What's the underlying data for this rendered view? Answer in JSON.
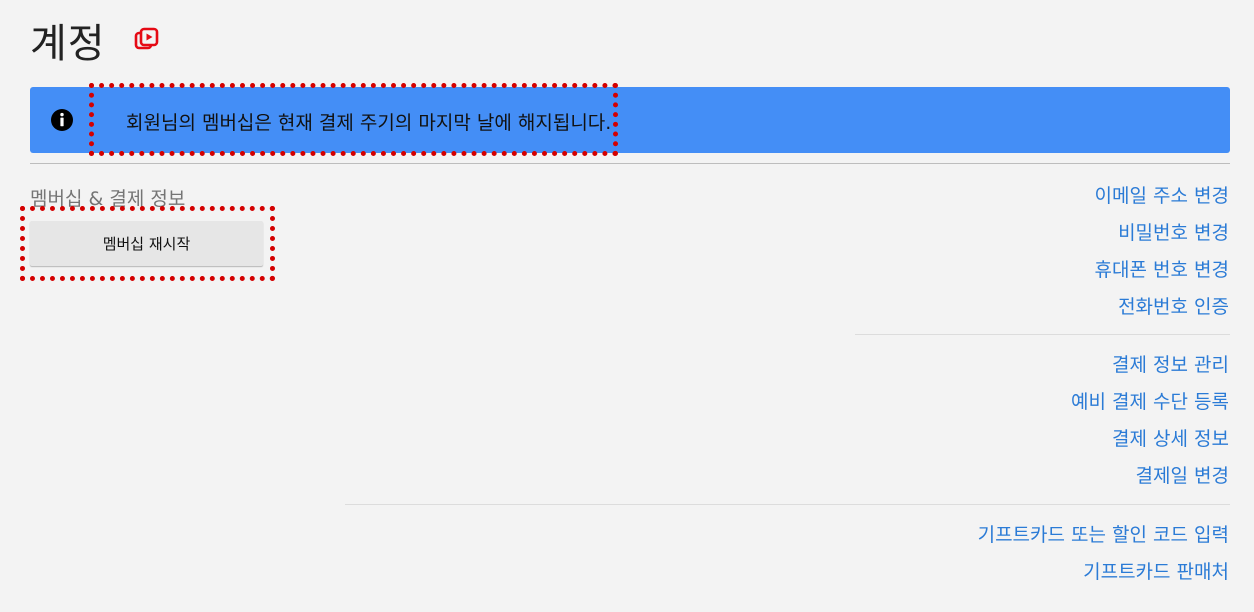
{
  "header": {
    "title": "계정",
    "icon": "membership-play-icon"
  },
  "banner": {
    "text": "회원님의 멤버십은 현재 결제 주기의 마지막 날에 해지됩니다.",
    "background": "#448ef6",
    "icon": "info-icon"
  },
  "membership": {
    "section_label": "멤버십 & 결제 정보",
    "restart_button_label": "멤버십 재시작"
  },
  "account_links": [
    "이메일 주소 변경",
    "비밀번호 변경",
    "휴대폰 번호 변경",
    "전화번호 인증"
  ],
  "billing_links": [
    "결제 정보 관리",
    "예비 결제 수단 등록",
    "결제 상세 정보",
    "결제일 변경"
  ],
  "gift_links": [
    "기프트카드 또는 할인 코드 입력",
    "기프트카드 판매처"
  ],
  "colors": {
    "link": "#2b7bd6",
    "accent_red": "#e50914",
    "annotation_red": "#d40000"
  }
}
